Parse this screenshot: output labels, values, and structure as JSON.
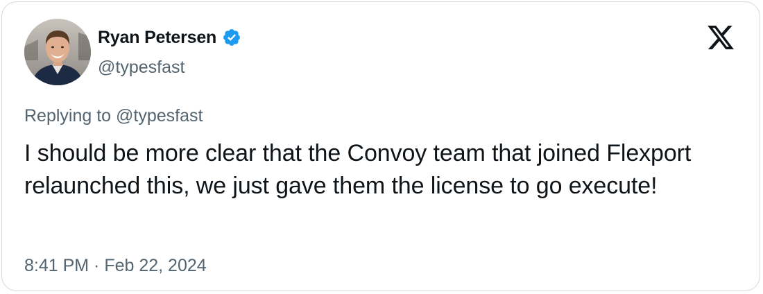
{
  "author": {
    "name": "Ryan Petersen",
    "handle": "@typesfast",
    "verified_color": "#1d9bf0"
  },
  "icons": {
    "verified": "verified-badge-icon",
    "brand": "x-logo-icon"
  },
  "tweet": {
    "reply_context": "Replying to @typesfast",
    "text": "I should be more clear that the Convoy team that joined Flexport relaunched this, we just gave them the license to go execute!",
    "time": "8:41 PM",
    "separator": " · ",
    "date": "Feb 22, 2024"
  },
  "colors": {
    "text_primary": "#0f1419",
    "text_secondary": "#536471",
    "border": "#cfd9de"
  }
}
